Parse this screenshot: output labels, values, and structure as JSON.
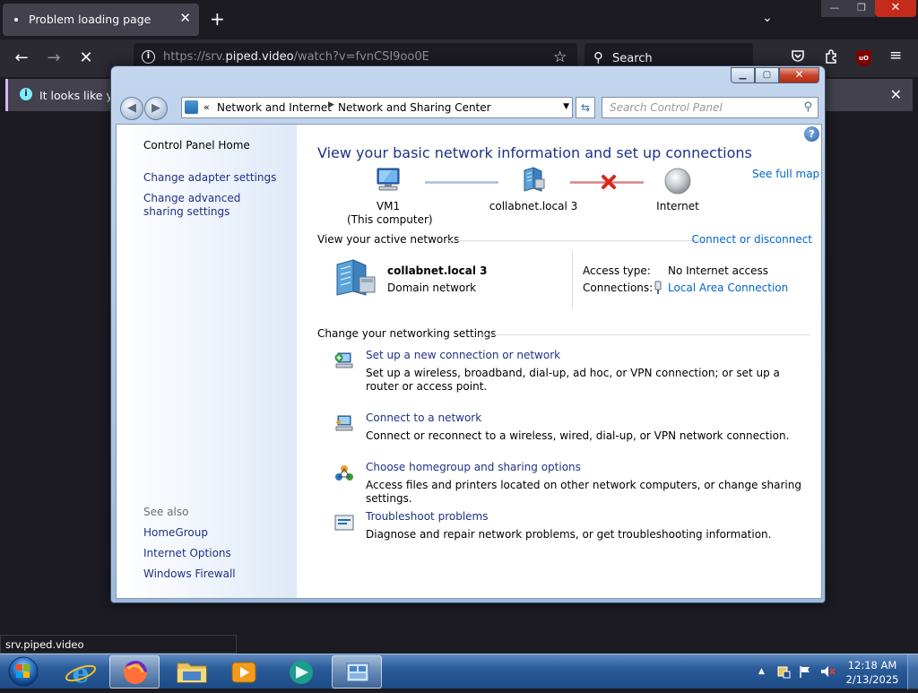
{
  "firefox": {
    "tab_title": "Problem loading page",
    "url_prefix": "https://srv.",
    "url_domain": "piped.video",
    "url_path": "/watch?v=fvnCSI9oo0E",
    "search_label": "Search",
    "notification_text": "It looks like yo",
    "status_url": "srv.piped.video",
    "ublock_label": "uO"
  },
  "cp": {
    "breadcrumb_caret": "«",
    "breadcrumb_1": "Network and Internet",
    "breadcrumb_2": "Network and Sharing Center",
    "search_placeholder": "Search Control Panel",
    "left": {
      "home": "Control Panel Home",
      "adapter": "Change adapter settings",
      "advanced": "Change advanced sharing settings",
      "see_also": "See also",
      "homegroup": "HomeGroup",
      "internet_options": "Internet Options",
      "firewall": "Windows Firewall"
    },
    "main": {
      "title": "View your basic network information and set up connections",
      "see_full_map": "See full map",
      "map": {
        "computer_name": "VM1",
        "computer_sub": "(This computer)",
        "network": "collabnet.local  3",
        "internet": "Internet"
      },
      "active_networks_heading": "View your active networks",
      "connect_disconnect": "Connect or disconnect",
      "network_name": "collabnet.local  3",
      "network_type": "Domain network",
      "access_type_label": "Access type:",
      "access_type_value": "No Internet access",
      "connections_label": "Connections:",
      "connections_value": "Local Area Connection",
      "change_heading": "Change your networking settings",
      "tasks": [
        {
          "link": "Set up a new connection or network",
          "desc": "Set up a wireless, broadband, dial-up, ad hoc, or VPN connection; or set up a router or access point."
        },
        {
          "link": "Connect to a network",
          "desc": "Connect or reconnect to a wireless, wired, dial-up, or VPN network connection."
        },
        {
          "link": "Choose homegroup and sharing options",
          "desc": "Access files and printers located on other network computers, or change sharing settings."
        },
        {
          "link": "Troubleshoot problems",
          "desc": "Diagnose and repair network problems, or get troubleshooting information."
        }
      ]
    }
  },
  "taskbar": {
    "time": "12:18 AM",
    "date": "2/13/2025"
  },
  "colors": {
    "link": "#1e3287",
    "hyperlink": "#0066cc",
    "firefox_dark": "#1c1b22",
    "taskbar": "#2a5c9a"
  }
}
